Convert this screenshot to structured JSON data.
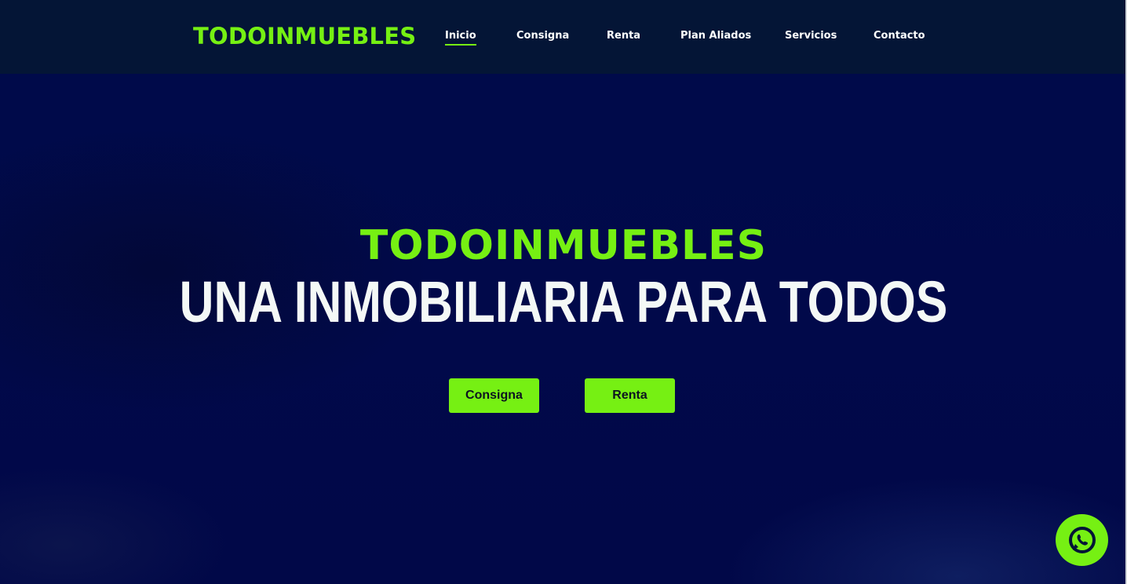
{
  "header": {
    "logo": "TODOINMUEBLES",
    "nav": [
      {
        "label": "Inicio",
        "active": true
      },
      {
        "label": "Consigna"
      },
      {
        "label": "Renta"
      },
      {
        "label": "Plan Aliados"
      },
      {
        "label": "Servicios"
      },
      {
        "label": "Contacto"
      }
    ]
  },
  "hero": {
    "brand": "TODOINMUEBLES",
    "title": "UNA INMOBILIARIA PARA TODOS",
    "buttons": [
      {
        "label": "Consigna"
      },
      {
        "label": "Renta"
      }
    ]
  },
  "fab": {
    "icon": "whatsapp-icon"
  },
  "colors": {
    "accent": "#76f013",
    "header_bg": "#041536",
    "hero_bg": "#000a46",
    "title_text": "#f4f8f6"
  }
}
